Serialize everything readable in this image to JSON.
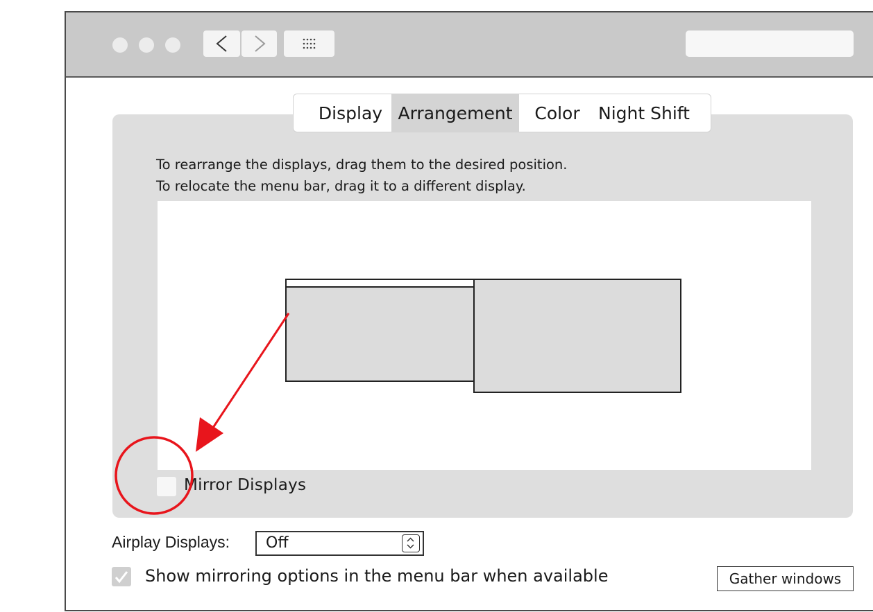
{
  "window": {
    "nav_back_glyph": "<",
    "nav_forward_glyph": ">",
    "search": {
      "value": ""
    }
  },
  "tabs": [
    {
      "label": "Display",
      "active": false
    },
    {
      "label": "Arrangement",
      "active": true
    },
    {
      "label": "Color",
      "active": false
    },
    {
      "label": "Night Shift",
      "active": false
    }
  ],
  "arrangement": {
    "instruction_line1": "To rearrange the displays, drag them to the desired position.",
    "instruction_line2": "To relocate the menu bar, drag it to a different display.",
    "mirror_label": "Mirror Displays",
    "mirror_checked": false
  },
  "airplay": {
    "label": "Airplay Displays:",
    "selected": "Off"
  },
  "show_mirroring": {
    "label": "Show mirroring options in the menu bar when available",
    "checked": true
  },
  "gather_label": "Gather windows",
  "colors": {
    "annotation": "#e8151c",
    "panel_bg": "#dedede",
    "titlebar_bg": "#c9c9c9",
    "display_fill": "#dcdcdc"
  },
  "icons": [
    "window-control-dot",
    "chevron-left-icon",
    "chevron-right-icon",
    "app-grid-icon",
    "stepper-arrows-icon",
    "checkmark-icon"
  ]
}
